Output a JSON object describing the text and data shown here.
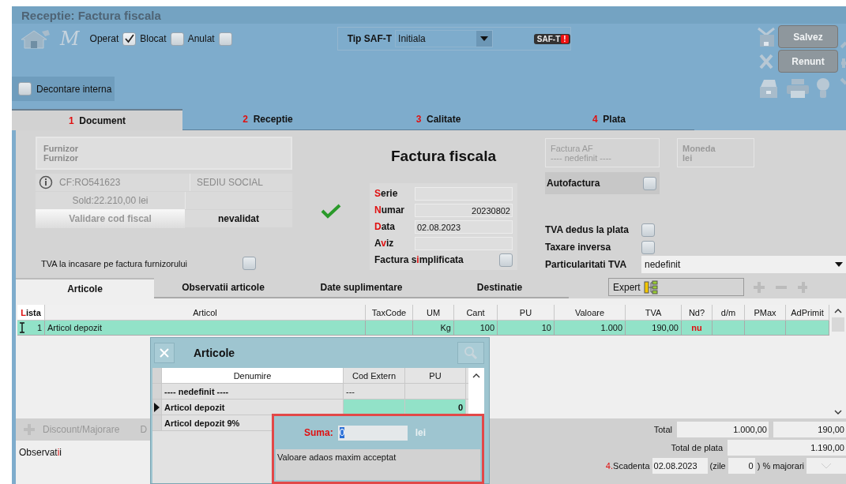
{
  "window": {
    "title": "Receptie: Factura fiscala"
  },
  "toolbar": {
    "logo": "M",
    "checks": [
      {
        "label": "Operat",
        "checked": true
      },
      {
        "label": "Blocat",
        "checked": false
      },
      {
        "label": "Anulat",
        "checked": false
      }
    ],
    "saft": {
      "label": "Tip SAF-T",
      "value": "Initiala",
      "badge": "SAF-T",
      "badge_mark": "!"
    },
    "buttons": [
      {
        "label": "Salvez",
        "disabled": true
      },
      {
        "label": "Renunt",
        "disabled": true
      }
    ],
    "decontare": {
      "label": "Decontare interna",
      "checked": false
    }
  },
  "tabs": [
    {
      "number": "1",
      "label": "Document",
      "selected": true
    },
    {
      "number": "2",
      "label": "Receptie",
      "selected": false
    },
    {
      "number": "3",
      "label": "Calitate",
      "selected": false
    },
    {
      "number": "4",
      "label": "Plata",
      "selected": false
    }
  ],
  "supplier": {
    "lines": [
      "Furnizor",
      "Furnizor"
    ],
    "cf": "CF:RO541623",
    "address": "SEDIU SOCIAL",
    "sold": "Sold:22.210,00 lei",
    "validate_label": "Validare cod fiscal",
    "validate_status": "nevalidat"
  },
  "tva_incasare": {
    "label": "TVA la incasare pe factura furnizorului",
    "checked": false
  },
  "doc_title": "Factura fiscala",
  "fields": [
    {
      "key": "S",
      "post": "erie"
    },
    {
      "key": "N",
      "post": "umar",
      "value": "20230802",
      "kind": "number"
    },
    {
      "key": "D",
      "post": "ata",
      "value": "02.08.2023",
      "kind": "date"
    },
    {
      "pre": "A",
      "key": "v",
      "post": "iz"
    }
  ],
  "simplificata": {
    "pre": "Factura s",
    "key": "i",
    "post": "mplificata",
    "checked": false
  },
  "factura_af": {
    "label": "Factura AF",
    "value": "---- nedefinit ----"
  },
  "moneda": {
    "label": "Moneda",
    "value": "lei"
  },
  "autofactura": {
    "label": "Autofactura",
    "checked": false
  },
  "tva_flags": [
    {
      "label": "TVA dedus la plata",
      "checked": false
    },
    {
      "label": "Taxare inversa",
      "checked": false
    }
  ],
  "particularitati": {
    "label": "Particularitati TVA",
    "value": "nedefinit"
  },
  "subtabs": [
    {
      "label": "Articole",
      "selected": true
    },
    {
      "label": "Observatii articole",
      "selected": false
    },
    {
      "label": "Date suplimentare",
      "selected": false
    },
    {
      "label": "Destinatie",
      "selected": false
    }
  ],
  "expert": {
    "label": "Expert"
  },
  "table": {
    "columns": [
      {
        "key": "L",
        "post": "ista",
        "kind": "marker"
      },
      {
        "post": "Articol",
        "kind": "text"
      },
      {
        "post": "TaxCode",
        "kind": "text"
      },
      {
        "post": "UM",
        "kind": "num"
      },
      {
        "post": "Cant",
        "kind": "num"
      },
      {
        "post": "PU",
        "kind": "num"
      },
      {
        "post": "Valoare",
        "kind": "num"
      },
      {
        "post": "TVA",
        "kind": "num"
      },
      {
        "post": "Nd?",
        "kind": "flag"
      },
      {
        "post": "d/m",
        "kind": "num"
      },
      {
        "post": "PMax",
        "kind": "num"
      },
      {
        "post": "AdPrimit",
        "kind": "num"
      }
    ],
    "rows": [
      {
        "selected": true,
        "cells": [
          "1",
          "Articol depozit",
          null,
          "Kg",
          "100",
          "10",
          "1.000",
          "190,00",
          "nu",
          null,
          null,
          null
        ]
      }
    ]
  },
  "discount": {
    "label": "Discount/Majorare",
    "cut": "D"
  },
  "observatii": {
    "pre": "Observat",
    "key": "i",
    "post": "i"
  },
  "totals": {
    "total_label": "Total",
    "total": "1.000,00",
    "tva": "190,00",
    "plata_label": "Total de plata",
    "plata": "1.190,00"
  },
  "scadenta": {
    "number": "4.",
    "label": "Scadenta",
    "date": "02.08.2023",
    "zile_label": "(zile",
    "zile": "0",
    "suffix": ") % majorari"
  },
  "popup": {
    "title": "Articole",
    "columns": [
      "Denumire",
      "Cod Extern",
      "PU"
    ],
    "rows": [
      {
        "name": "---- nedefinit ----",
        "cod": "---",
        "selected": false
      },
      {
        "name": "Articol depozit",
        "pu": "0",
        "selected": true
      },
      {
        "name": "Articol depozit 9%",
        "selected": false
      }
    ]
  },
  "suma": {
    "label": "Suma:",
    "value": "0",
    "unit": "lei",
    "note": "Valoare adaos maxim acceptat"
  }
}
